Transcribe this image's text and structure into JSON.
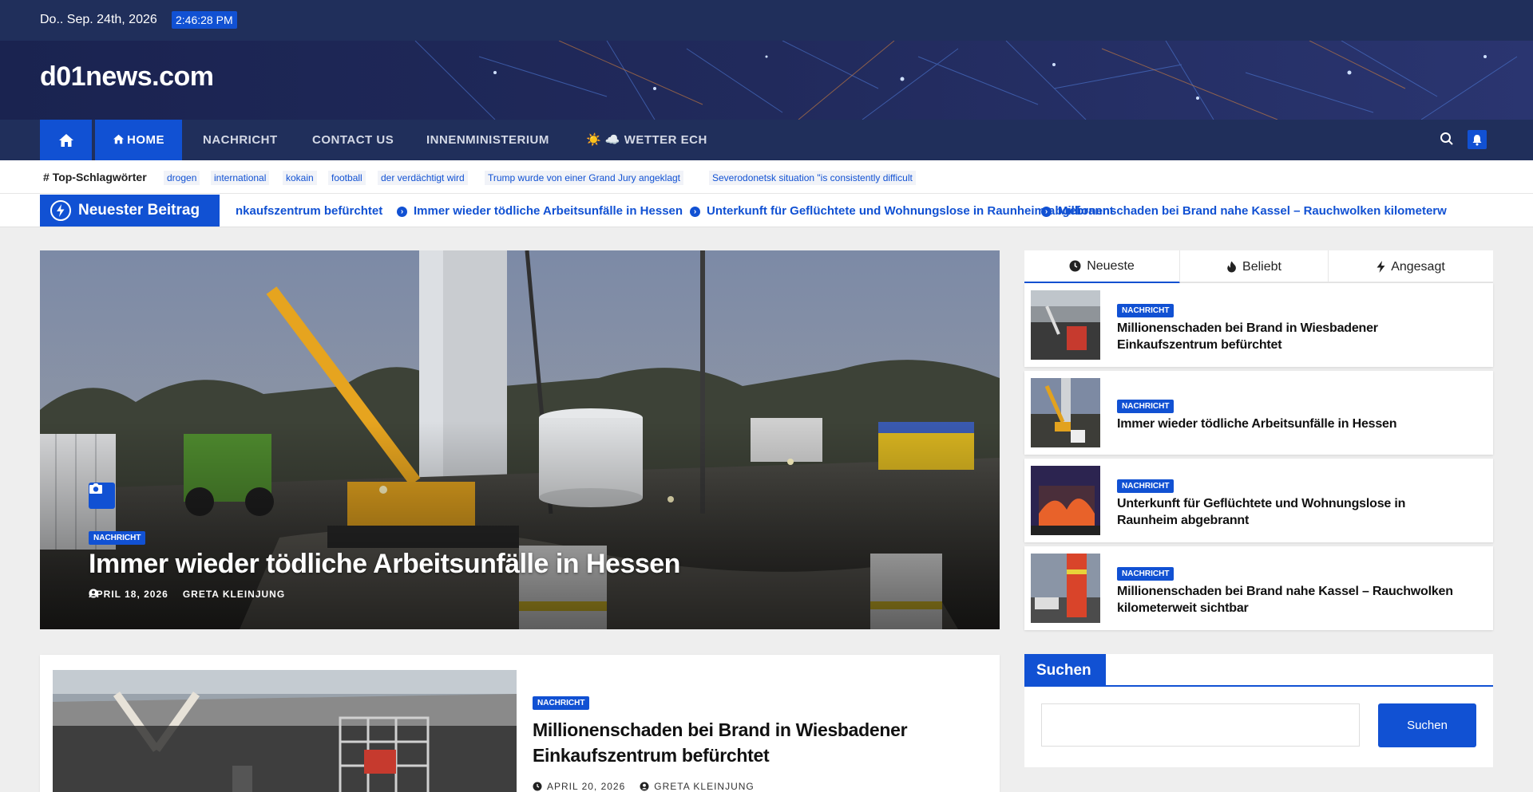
{
  "topbar": {
    "date": "Do.. Sep. 24th, 2026",
    "time": "2:46:28 PM"
  },
  "site": {
    "logo": "d01news.com"
  },
  "nav": {
    "home_icon": "home-icon",
    "items": [
      {
        "label": "HOME",
        "icon": "home-icon",
        "active": true
      },
      {
        "label": "NACHRICHT"
      },
      {
        "label": "CONTACT US"
      },
      {
        "label": "INNENMINISTERIUM"
      },
      {
        "label": "☀️ ☁️ WETTER ECH"
      }
    ],
    "search_icon": "search-icon",
    "bell_icon": "bell-icon"
  },
  "tags": {
    "label": "Top-Schlagwörter",
    "items": [
      "drogen",
      "international",
      "kokain",
      "football",
      "der verdächtigt wird",
      "Trump wurde von einer Grand Jury angeklagt",
      "Severodonetsk situation \"is consistently difficult"
    ]
  },
  "ticker": {
    "label": "Neuester Beitrag",
    "items": [
      "nkaufszentrum befürchtet",
      "Immer wieder tödliche Arbeitsunfälle in Hessen",
      "Unterkunft für Geflüchtete und Wohnungslose in Raunheim abgebrannt",
      "Millionenschaden bei Brand nahe Kassel – Rauchwolken kilometerw"
    ]
  },
  "hero": {
    "category": "NACHRICHT",
    "title": "Immer wieder tödliche Arbeitsunfälle in Hessen",
    "date": "APRIL 18, 2026",
    "author": "GRETA KLEINJUNG"
  },
  "post2": {
    "category": "NACHRICHT",
    "title": "Millionenschaden bei Brand in Wiesbadener Einkaufszentrum befürchtet",
    "date": "APRIL 20, 2026",
    "author": "GRETA KLEINJUNG"
  },
  "sidebar": {
    "tabs": [
      {
        "label": "Neueste",
        "icon": "clock-icon",
        "active": true
      },
      {
        "label": "Beliebt",
        "icon": "fire-icon"
      },
      {
        "label": "Angesagt",
        "icon": "bolt-icon"
      }
    ],
    "items": [
      {
        "category": "NACHRICHT",
        "title": "Millionenschaden bei Brand in Wiesbadener Einkaufszentrum befürchtet"
      },
      {
        "category": "NACHRICHT",
        "title": "Immer wieder tödliche Arbeitsunfälle in Hessen"
      },
      {
        "category": "NACHRICHT",
        "title": "Unterkunft für Geflüchtete und Wohnungslose in Raunheim abgebrannt"
      },
      {
        "category": "NACHRICHT",
        "title": "Millionenschaden bei Brand nahe Kassel – Rauchwolken kilometerweit sichtbar"
      }
    ]
  },
  "search_widget": {
    "title": "Suchen",
    "input_value": "",
    "button": "Suchen"
  },
  "colors": {
    "primary": "#1151d3",
    "navy": "#202f5b",
    "header_bg": "#1b2450"
  }
}
